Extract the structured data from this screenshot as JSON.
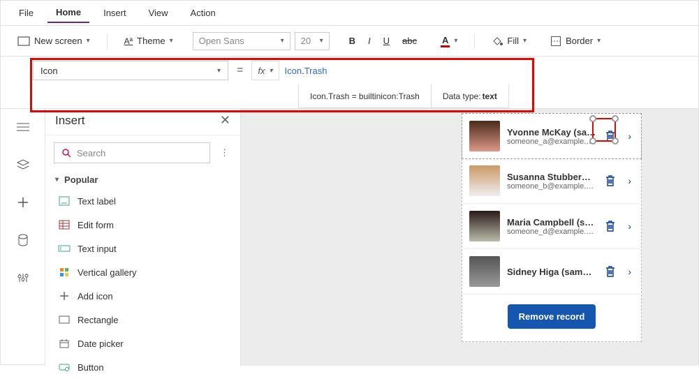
{
  "menu": {
    "tabs": [
      "File",
      "Home",
      "Insert",
      "View",
      "Action"
    ],
    "active": 1
  },
  "toolbar": {
    "new_screen": "New screen",
    "theme": "Theme",
    "font": "Open Sans",
    "size": "20",
    "fill": "Fill",
    "border": "Border"
  },
  "property_bar": {
    "selected_property": "Icon",
    "fx": "fx",
    "formula_ns": "Icon",
    "formula_member": "Trash",
    "hint_left": "Icon.Trash  =  builtinicon:Trash",
    "hint_right_label": "Data type: ",
    "hint_right_value": "text"
  },
  "insert_panel": {
    "title": "Insert",
    "search_placeholder": "Search",
    "popular_label": "Popular",
    "items": [
      {
        "icon": "text-label",
        "label": "Text label"
      },
      {
        "icon": "edit-form",
        "label": "Edit form"
      },
      {
        "icon": "text-input",
        "label": "Text input"
      },
      {
        "icon": "vertical-gallery",
        "label": "Vertical gallery"
      },
      {
        "icon": "add-icon",
        "label": "Add icon"
      },
      {
        "icon": "rectangle",
        "label": "Rectangle"
      },
      {
        "icon": "date-picker",
        "label": "Date picker"
      },
      {
        "icon": "button",
        "label": "Button"
      }
    ]
  },
  "gallery": {
    "items": [
      {
        "name": "Yvonne McKay (sample)",
        "email": "someone_a@example.com"
      },
      {
        "name": "Susanna Stubberod (sample)",
        "email": "someone_b@example.com"
      },
      {
        "name": "Maria Campbell (sample)",
        "email": "someone_d@example.com"
      },
      {
        "name": "Sidney Higa (sample)",
        "email": ""
      }
    ],
    "remove_label": "Remove record"
  }
}
